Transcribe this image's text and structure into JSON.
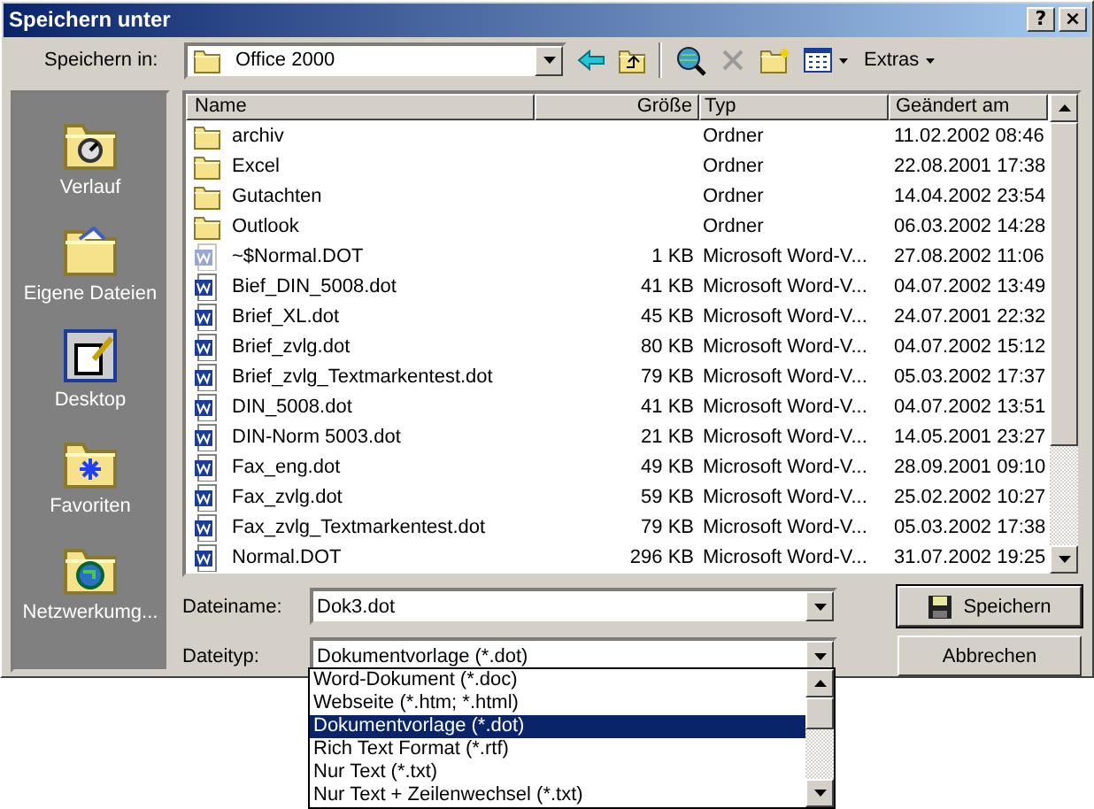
{
  "window": {
    "title": "Speichern unter",
    "buttons": [
      "?",
      "×"
    ]
  },
  "location": {
    "label": "Speichern in:",
    "value": "Office 2000"
  },
  "toolbar": {
    "menu": "Extras"
  },
  "places": [
    {
      "label": "Verlauf",
      "kind": "history"
    },
    {
      "label": "Eigene Dateien",
      "kind": "documents"
    },
    {
      "label": "Desktop",
      "kind": "desktop"
    },
    {
      "label": "Favoriten",
      "kind": "favorites"
    },
    {
      "label": "Netzwerkumg...",
      "kind": "network"
    }
  ],
  "file_list": {
    "columns": [
      "Name",
      "Größe",
      "Typ",
      "Geändert am"
    ],
    "rows": [
      {
        "kind": "folder",
        "hidden": false,
        "name": "archiv",
        "type": "Ordner",
        "modified": "11.02.2002 08:46"
      },
      {
        "kind": "folder",
        "hidden": false,
        "name": "Excel",
        "type": "Ordner",
        "modified": "22.08.2001 17:38"
      },
      {
        "kind": "folder",
        "hidden": false,
        "name": "Gutachten",
        "type": "Ordner",
        "modified": "14.04.2002 23:54"
      },
      {
        "kind": "folder",
        "hidden": false,
        "name": "Outlook",
        "type": "Ordner",
        "modified": "06.03.2002 14:28"
      },
      {
        "kind": "document",
        "hidden": true,
        "name": "~$Normal.DOT",
        "size": "1 KB",
        "type": "Microsoft Word-V...",
        "modified": "27.08.2002 11:06"
      },
      {
        "kind": "document",
        "hidden": false,
        "name": "Bief_DIN_5008.dot",
        "size": "41 KB",
        "type": "Microsoft Word-V...",
        "modified": "04.07.2002 13:49"
      },
      {
        "kind": "document",
        "hidden": false,
        "name": "Brief_XL.dot",
        "size": "45 KB",
        "type": "Microsoft Word-V...",
        "modified": "24.07.2001 22:32"
      },
      {
        "kind": "document",
        "hidden": false,
        "name": "Brief_zvlg.dot",
        "size": "80 KB",
        "type": "Microsoft Word-V...",
        "modified": "04.07.2002 15:12"
      },
      {
        "kind": "document",
        "hidden": false,
        "name": "Brief_zvlg_Textmarkentest.dot",
        "size": "79 KB",
        "type": "Microsoft Word-V...",
        "modified": "05.03.2002 17:37"
      },
      {
        "kind": "document",
        "hidden": false,
        "name": "DIN_5008.dot",
        "size": "41 KB",
        "type": "Microsoft Word-V...",
        "modified": "04.07.2002 13:51"
      },
      {
        "kind": "document",
        "hidden": false,
        "name": "DIN-Norm 5003.dot",
        "size": "21 KB",
        "type": "Microsoft Word-V...",
        "modified": "14.05.2001 23:27"
      },
      {
        "kind": "document",
        "hidden": false,
        "name": "Fax_eng.dot",
        "size": "49 KB",
        "type": "Microsoft Word-V...",
        "modified": "28.09.2001 09:10"
      },
      {
        "kind": "document",
        "hidden": false,
        "name": "Fax_zvlg.dot",
        "size": "59 KB",
        "type": "Microsoft Word-V...",
        "modified": "25.02.2002 10:27"
      },
      {
        "kind": "document",
        "hidden": false,
        "name": "Fax_zvlg_Textmarkentest.dot",
        "size": "79 KB",
        "type": "Microsoft Word-V...",
        "modified": "05.03.2002 17:38"
      },
      {
        "kind": "document",
        "hidden": false,
        "name": "Normal.DOT",
        "size": "296 KB",
        "type": "Microsoft Word-V...",
        "modified": "31.07.2002 19:25"
      }
    ]
  },
  "filename": {
    "label": "Dateiname:",
    "value": "Dok3.dot"
  },
  "filetype": {
    "label": "Dateityp:",
    "value": "Dokumentvorlage (*.dot)",
    "options": [
      {
        "label": "Word-Dokument (*.doc)",
        "selected": false
      },
      {
        "label": "Webseite (*.htm; *.html)",
        "selected": false
      },
      {
        "label": "Dokumentvorlage (*.dot)",
        "selected": true
      },
      {
        "label": "Rich Text Format (*.rtf)",
        "selected": false
      },
      {
        "label": "Nur Text (*.txt)",
        "selected": false
      },
      {
        "label": "Nur Text + Zeilenwechsel (*.txt)",
        "selected": false
      }
    ]
  },
  "buttons": [
    {
      "label": "Speichern",
      "kind": "save"
    },
    {
      "label": "Abbrechen",
      "kind": "cancel"
    }
  ]
}
